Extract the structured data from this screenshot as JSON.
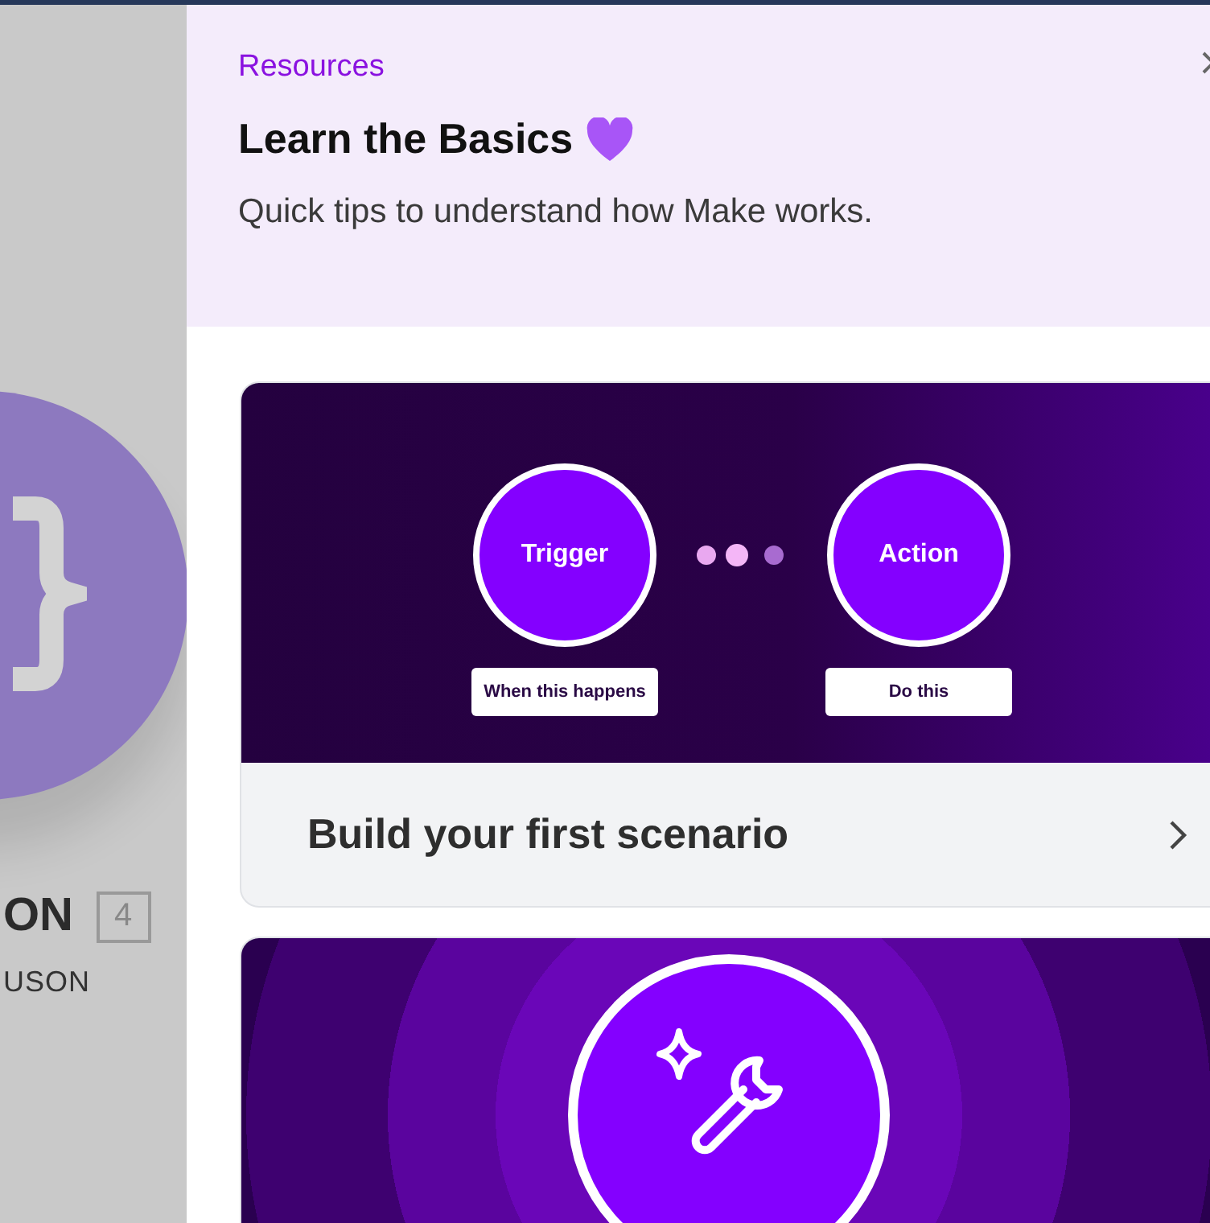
{
  "backdrop": {
    "name_fragment": "ON",
    "count": "4",
    "subtitle_fragment": "USON"
  },
  "panel": {
    "eyebrow": "Resources",
    "title": "Learn the Basics",
    "subtitle": "Quick tips to understand how Make works."
  },
  "cards": [
    {
      "kind": "flow",
      "title": "Build your first scenario",
      "nodes": [
        {
          "name": "Trigger",
          "caption": "When this happens"
        },
        {
          "name": "Action",
          "caption": "Do this"
        }
      ]
    },
    {
      "kind": "tools"
    }
  ]
}
